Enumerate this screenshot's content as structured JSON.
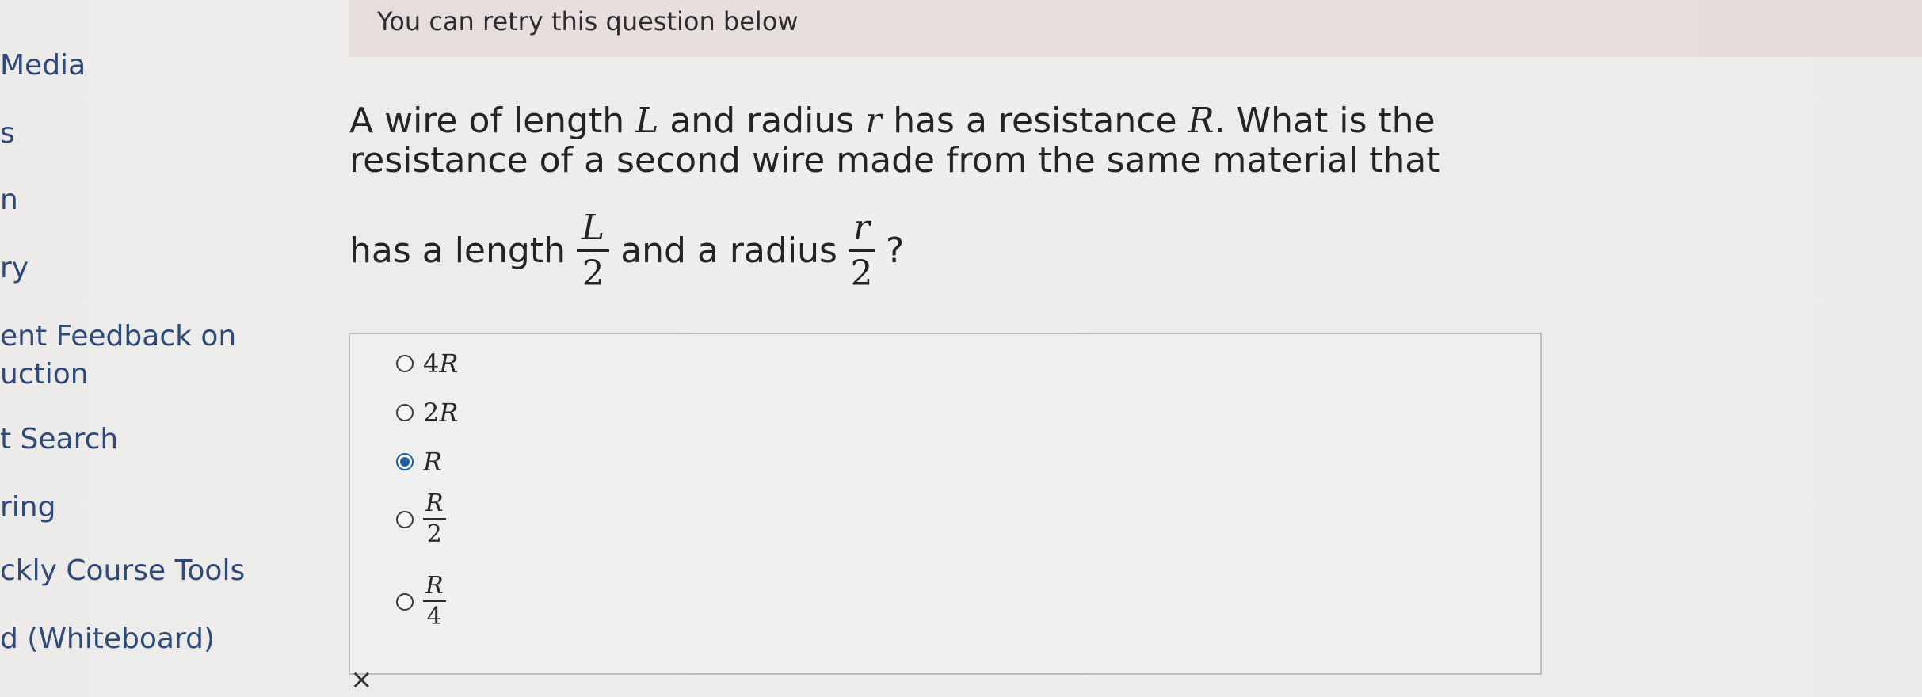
{
  "sidebar": {
    "items": [
      {
        "label": "Media"
      },
      {
        "label": "s"
      },
      {
        "label": "n"
      },
      {
        "label": "ry"
      },
      {
        "label": "ent Feedback on"
      },
      {
        "label": "uction"
      },
      {
        "label": "t Search"
      },
      {
        "label": "ring"
      },
      {
        "label": "ckly Course Tools"
      },
      {
        "label": "d (Whiteboard)"
      }
    ]
  },
  "banner": {
    "text": "You can retry this question below"
  },
  "question": {
    "line1_a": "A wire of length",
    "L": "L",
    "line1_b": "and radius",
    "r": "r",
    "line1_c": "has a resistance",
    "R": "R",
    "line1_d": ". What is the",
    "line2": "resistance of a second wire made from the same material that",
    "line3_a": "has a length",
    "frac1_num": "L",
    "frac1_den": "2",
    "line3_b": "and a radius",
    "frac2_num": "r",
    "frac2_den": "2",
    "line3_c": "?"
  },
  "answers": {
    "options": [
      {
        "coef": "4",
        "var": "R",
        "selected": false
      },
      {
        "coef": "2",
        "var": "R",
        "selected": false
      },
      {
        "coef": "",
        "var": "R",
        "selected": true
      },
      {
        "num": "R",
        "den": "2",
        "selected": false
      },
      {
        "num": "R",
        "den": "4",
        "selected": false
      }
    ]
  },
  "close_glyph": "×",
  "colors": {
    "nav_link": "#2f4a78",
    "radio_selected": "#1f5fa8",
    "banner_bg": "#e8dede"
  }
}
